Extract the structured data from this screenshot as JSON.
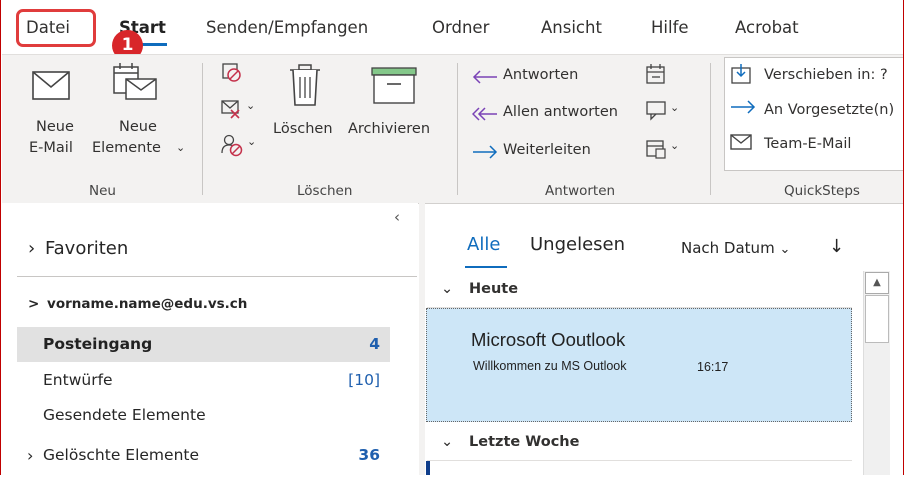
{
  "menu": {
    "tabs": [
      "Datei",
      "Start",
      "Senden/Empfangen",
      "Ordner",
      "Ansicht",
      "Hilfe",
      "Acrobat"
    ],
    "step_badge": "1"
  },
  "ribbon": {
    "new_email_line1": "Neue",
    "new_email_line2": "E-Mail",
    "new_items_line1": "Neue",
    "new_items_line2": "Elemente",
    "group_new": "Neu",
    "delete_label": "Löschen",
    "archive_label": "Archivieren",
    "group_delete": "Löschen",
    "reply_label": "Antworten",
    "reply_all_label": "Allen antworten",
    "forward_label": "Weiterleiten",
    "group_respond": "Antworten",
    "qs_move": "Verschieben in: ?",
    "qs_manager": "An Vorgesetzte(n)",
    "qs_team": "Team-E-Mail",
    "group_quicksteps": "QuickSteps"
  },
  "nav": {
    "favorites": "Favoriten",
    "account": "vorname.name@edu.vs.ch",
    "folders": [
      {
        "name": "Posteingang",
        "count": "4"
      },
      {
        "name": "Entwürfe",
        "count": "[10]"
      },
      {
        "name": "Gesendete Elemente",
        "count": ""
      },
      {
        "name": "Gelöschte Elemente",
        "count": "36"
      }
    ]
  },
  "list": {
    "filter_all": "Alle",
    "filter_unread": "Ungelesen",
    "sort": "Nach Datum",
    "group_today": "Heute",
    "group_last_week": "Letzte Woche",
    "messages": [
      {
        "sender": "Microsoft Ooutlook",
        "preview": "Willkommen zu MS Outlook",
        "time": "16:17"
      }
    ]
  },
  "colors": {
    "accent": "#0f6cbd",
    "highlight_box": "#e03c3c",
    "badge": "#d8262a",
    "selected_mail": "#cde6f7"
  }
}
